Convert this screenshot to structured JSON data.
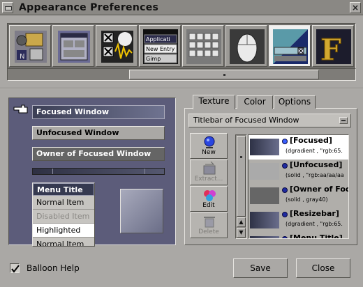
{
  "window": {
    "title": "Appearance Preferences",
    "close_glyph": "×"
  },
  "strip": {
    "items": [
      {
        "name": "desktop-icons-icon"
      },
      {
        "name": "layout-icon"
      },
      {
        "name": "sound-icon"
      },
      {
        "name": "menu-icon",
        "lines": [
          "Applicati",
          "New Entry",
          "Gimp"
        ]
      },
      {
        "name": "keyboard-icon"
      },
      {
        "name": "mouse-icon"
      },
      {
        "name": "appearance-icon"
      },
      {
        "name": "font-icon",
        "glyph": "F"
      }
    ],
    "selected_index": 6
  },
  "preview": {
    "focused": "Focused Window",
    "unfocused": "Unfocused Window",
    "owner": "Owner of Focused Window",
    "menu": {
      "title": "Menu Title",
      "items": [
        {
          "label": "Normal Item",
          "state": "normal"
        },
        {
          "label": "Disabled Item",
          "state": "disabled"
        },
        {
          "label": "Highlighted",
          "state": "highlighted"
        },
        {
          "label": "Normal Item",
          "state": "normal"
        }
      ]
    }
  },
  "tabs": [
    {
      "label": "Texture",
      "active": true
    },
    {
      "label": "Color",
      "active": false
    },
    {
      "label": "Options",
      "active": false
    }
  ],
  "texture": {
    "dropdown_value": "Titlebar of Focused Window",
    "tools": [
      {
        "label": "New",
        "icon": "new-icon",
        "enabled": true
      },
      {
        "label": "Extract...",
        "icon": "extract-icon",
        "enabled": false
      },
      {
        "label": "Edit",
        "icon": "edit-icon",
        "enabled": true
      },
      {
        "label": "Delete",
        "icon": "delete-icon",
        "enabled": false
      }
    ],
    "list": [
      {
        "name": "[Focused]",
        "desc": "(dgradient , \"rgb:65.",
        "thumb": "linear-gradient(90deg,#2e3246,#6a6e8c)",
        "selected": true
      },
      {
        "name": "[Unfocused]",
        "desc": "(solid , \"rgb:aa/aa/aa",
        "thumb": "#aaaaaa",
        "selected": false
      },
      {
        "name": "[Owner of Focu",
        "desc": "(solid , gray40)",
        "thumb": "#666666",
        "selected": false
      },
      {
        "name": "[Resizebar]",
        "desc": "(dgradient , \"rgb:65.",
        "thumb": "linear-gradient(90deg,#2e3246,#6a6e8c)",
        "selected": false
      },
      {
        "name": "[Menu Title]",
        "desc": "",
        "thumb": "linear-gradient(90deg,#2e3246,#6a6e8c)",
        "selected": false
      }
    ]
  },
  "footer": {
    "balloon_help": "Balloon Help",
    "balloon_checked": true,
    "save": "Save",
    "close": "Close"
  },
  "colors": {
    "background": "#aaa8a5",
    "preview_bg": "#5c5c7a",
    "focused_title": "#3c3f55",
    "highlight": "#ffffff"
  }
}
